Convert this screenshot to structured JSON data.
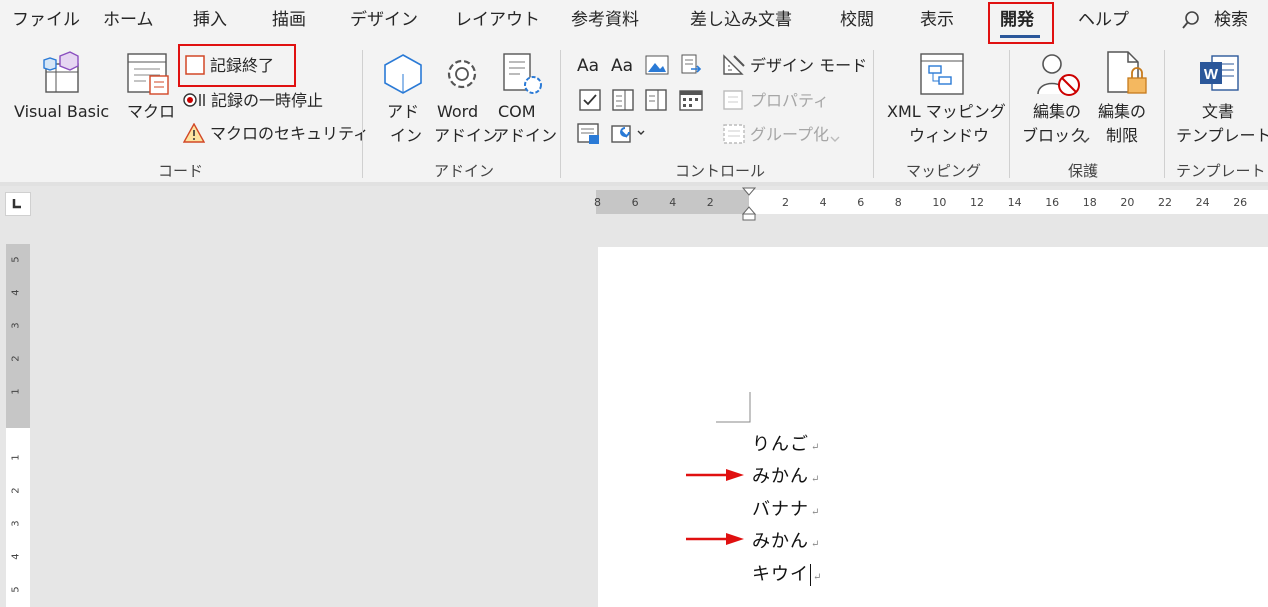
{
  "tabs": [
    "ファイル",
    "ホーム",
    "挿入",
    "描画",
    "デザイン",
    "レイアウト",
    "参考資料",
    "差し込み文書",
    "校閲",
    "表示",
    "開発",
    "ヘルプ"
  ],
  "search_label": "検索",
  "groups": {
    "code": {
      "label": "コード",
      "visual_basic": "Visual Basic",
      "macro": "マクロ",
      "stop_recording": "記録終了",
      "pause_recording": "記録の一時停止",
      "macro_security": "マクロのセキュリティ"
    },
    "addin": {
      "label": "アドイン",
      "addin_l1": "アド",
      "addin_l2": "イン",
      "word_addin_l1": "Word",
      "word_addin_l2": "アドイン",
      "com_addin_l1": "COM",
      "com_addin_l2": "アドイン"
    },
    "controls": {
      "label": "コントロール",
      "design_mode": "デザイン モード",
      "properties": "プロパティ",
      "group": "グループ化"
    },
    "mapping": {
      "label": "マッピング",
      "xml_l1": "XML マッピング",
      "xml_l2": "ウィンドウ"
    },
    "protect": {
      "label": "保護",
      "block_l1": "編集の",
      "block_l2": "ブロック",
      "restrict_l1": "編集の",
      "restrict_l2": "制限"
    },
    "templates": {
      "label": "テンプレート",
      "doc_l1": "文書",
      "doc_l2": "テンプレート"
    }
  },
  "ruler_h_numbers": [
    "8",
    "6",
    "4",
    "2",
    "",
    "2",
    "4",
    "6",
    "8",
    "10",
    "12",
    "14",
    "16",
    "18",
    "20",
    "22",
    "24",
    "26"
  ],
  "ruler_v_numbers": [
    "5",
    "4",
    "3",
    "2",
    "1",
    "",
    "1",
    "2",
    "3",
    "4",
    "5"
  ],
  "document": {
    "lines": [
      "りんご",
      "みかん",
      "バナナ",
      "みかん",
      "キウイ"
    ]
  },
  "colors": {
    "highlight_red": "#e01010",
    "accent_blue": "#2b579a"
  }
}
